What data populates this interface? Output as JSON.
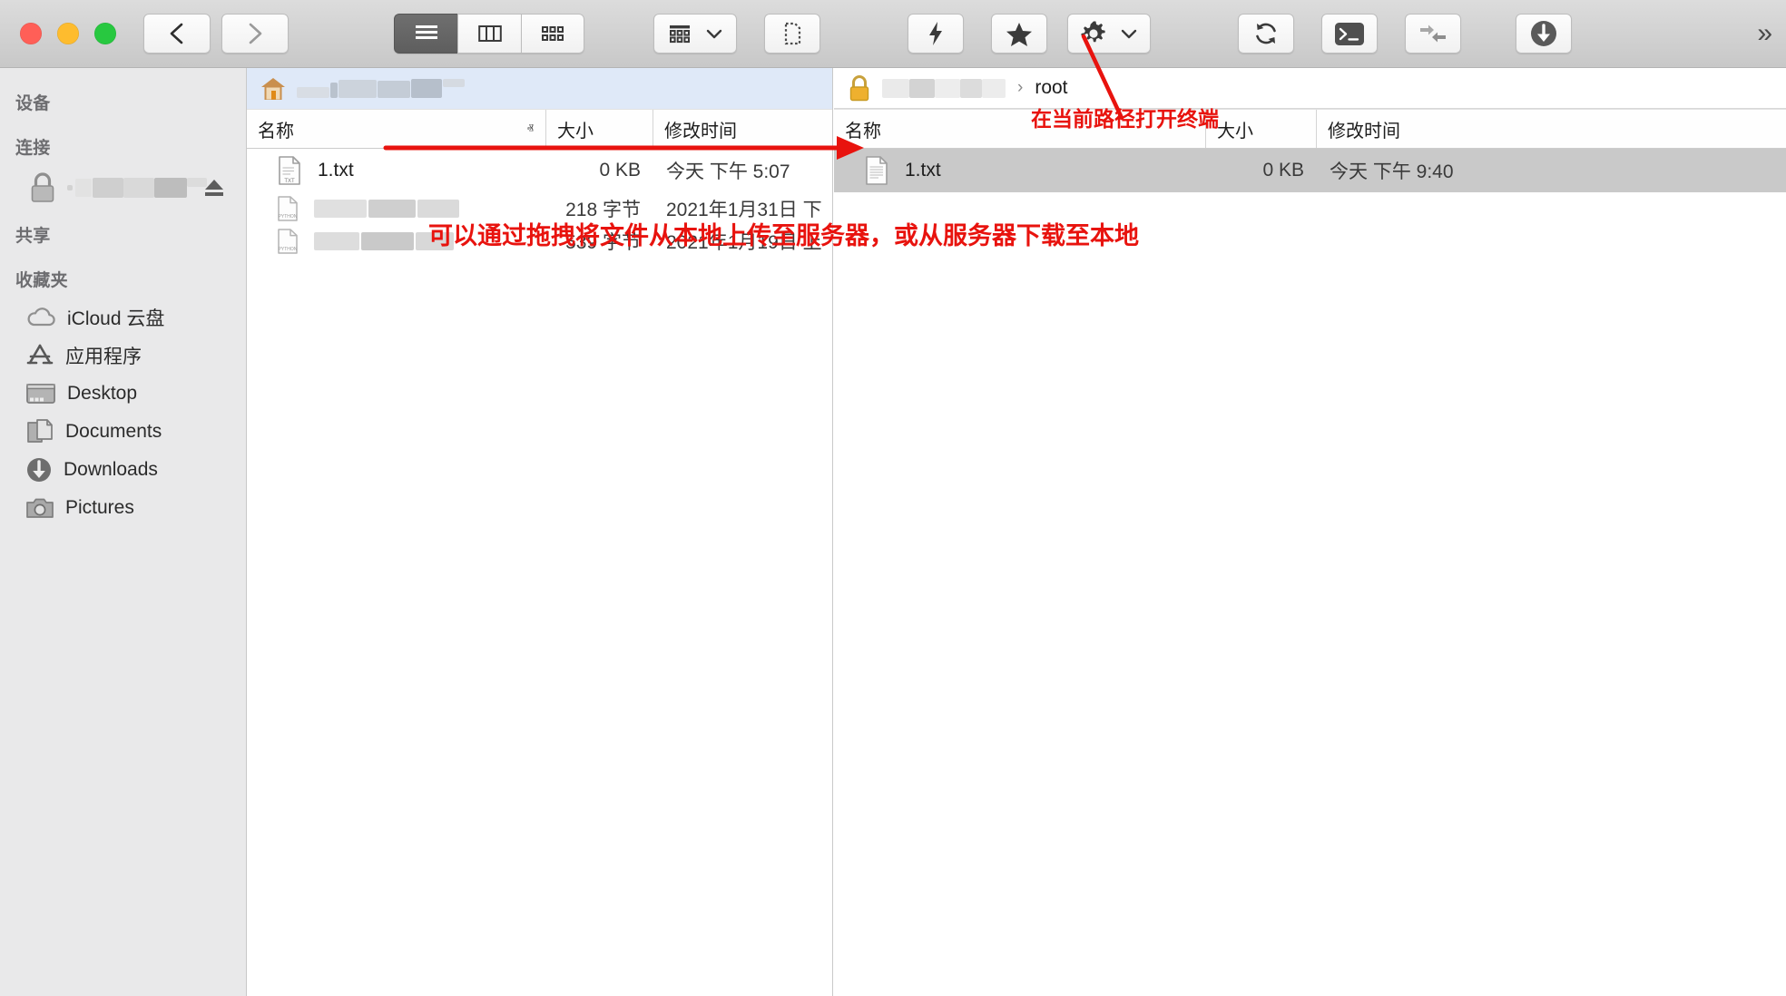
{
  "window": {
    "traffic_lights": [
      "close",
      "minimize",
      "zoom"
    ],
    "colors": {
      "close": "#ff5f57",
      "minimize": "#febc2e",
      "zoom": "#28c840",
      "annotation_red": "#e8130e",
      "selection_blue": "#dfe9f8",
      "row_selected_gray": "#c9c9c9",
      "sidebar_bg": "#e9e9ea"
    }
  },
  "toolbar": {
    "back_icon": "chevron-left-icon",
    "forward_icon": "chevron-right-icon",
    "view_list_icon": "list-view-icon",
    "view_columns_icon": "column-view-icon",
    "view_grid_icon": "grid-view-icon",
    "arrange_icon": "arrange-icon",
    "arrange_chevron_icon": "chevron-down-icon",
    "new_selection_icon": "dashed-rect-icon",
    "quick_action_icon": "lightning-bolt-icon",
    "favorite_icon": "star-icon",
    "settings_icon": "gear-icon",
    "settings_chevron_icon": "chevron-down-icon",
    "refresh_icon": "refresh-icon",
    "terminal_icon": "terminal-icon",
    "sync_icon": "sync-arrows-icon",
    "download_icon": "download-circle-icon",
    "overflow_label": "»"
  },
  "sidebar": {
    "sections": [
      {
        "header": "设备",
        "items": []
      },
      {
        "header": "连接",
        "items": [
          {
            "label": "",
            "redacted": true,
            "icon": "lock-icon",
            "eject_icon": "eject-icon"
          }
        ]
      },
      {
        "header": "共享",
        "items": []
      },
      {
        "header": "收藏夹",
        "items": [
          {
            "label": "iCloud 云盘",
            "icon": "cloud-icon"
          },
          {
            "label": "应用程序",
            "icon": "applications-icon"
          },
          {
            "label": "Desktop",
            "icon": "desktop-icon"
          },
          {
            "label": "Documents",
            "icon": "documents-icon"
          },
          {
            "label": "Downloads",
            "icon": "downloads-icon"
          },
          {
            "label": "Pictures",
            "icon": "pictures-icon"
          }
        ]
      }
    ]
  },
  "left_pane": {
    "path": {
      "icon": "home-icon",
      "label": "",
      "redacted": true,
      "selected": true
    },
    "columns": [
      {
        "key": "name",
        "label": "名称",
        "sorted": true,
        "sort_dir": "asc",
        "caret": "ⱏ"
      },
      {
        "key": "size",
        "label": "大小"
      },
      {
        "key": "date",
        "label": "修改时间"
      }
    ],
    "rows": [
      {
        "name": "1.txt",
        "icon": "txt-file-icon",
        "redacted": false,
        "size": "0 KB",
        "date": "今天 下午 5:07"
      },
      {
        "name": "",
        "icon": "python-file-icon",
        "redacted": true,
        "size": "218 字节",
        "date": "2021年1月31日 下"
      },
      {
        "name": "",
        "icon": "python-file-icon",
        "redacted": true,
        "size": "539 字节",
        "date": "2021年1月19日 上"
      }
    ]
  },
  "right_pane": {
    "path": {
      "icon": "lock-icon-gold",
      "host": "",
      "host_redacted": true,
      "separator": "›",
      "current": "root"
    },
    "columns": [
      {
        "key": "name",
        "label": "名称"
      },
      {
        "key": "size",
        "label": "大小"
      },
      {
        "key": "date",
        "label": "修改时间"
      }
    ],
    "rows": [
      {
        "name": "1.txt",
        "icon": "text-file-icon",
        "size": "0 KB",
        "date": "今天 下午 9:40",
        "selected": true
      }
    ]
  },
  "annotations": [
    {
      "id": "terminal-hint",
      "text": "在当前路径打开终端"
    },
    {
      "id": "drag-hint",
      "text": "可以通过拖拽将文件从本地上传至服务器，或从服务器下载至本地"
    }
  ]
}
